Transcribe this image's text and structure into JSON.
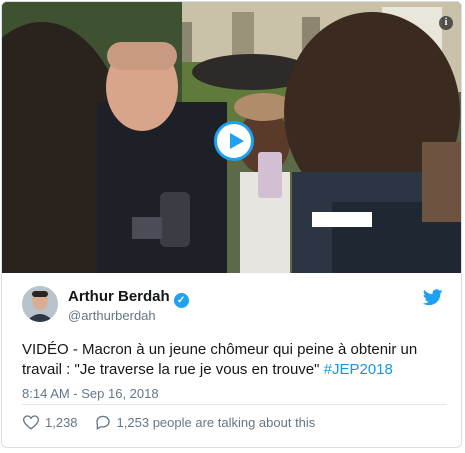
{
  "tweet": {
    "author_name": "Arthur Berdah",
    "author_handle": "@arthurberdah",
    "text_main": "VIDÉO - Macron à un jeune chômeur qui peine à obtenir un travail : \"Je traverse la rue je vous en trouve\" ",
    "hashtag": "#JEP2018",
    "timestamp": "8:14 AM - Sep 16, 2018",
    "likes": "1,238",
    "talking": "1,253 people are talking about this"
  },
  "media": {
    "info_glyph": "i"
  },
  "icons": {
    "info": "info-icon",
    "play": "play-icon",
    "verified": "verified-badge-icon",
    "bird": "twitter-bird-icon",
    "heart": "heart-icon",
    "reply": "reply-bubble-icon"
  },
  "colors": {
    "accent": "#1da1f2",
    "link": "#1b95e0",
    "text": "#14171a",
    "muted": "#657786"
  }
}
